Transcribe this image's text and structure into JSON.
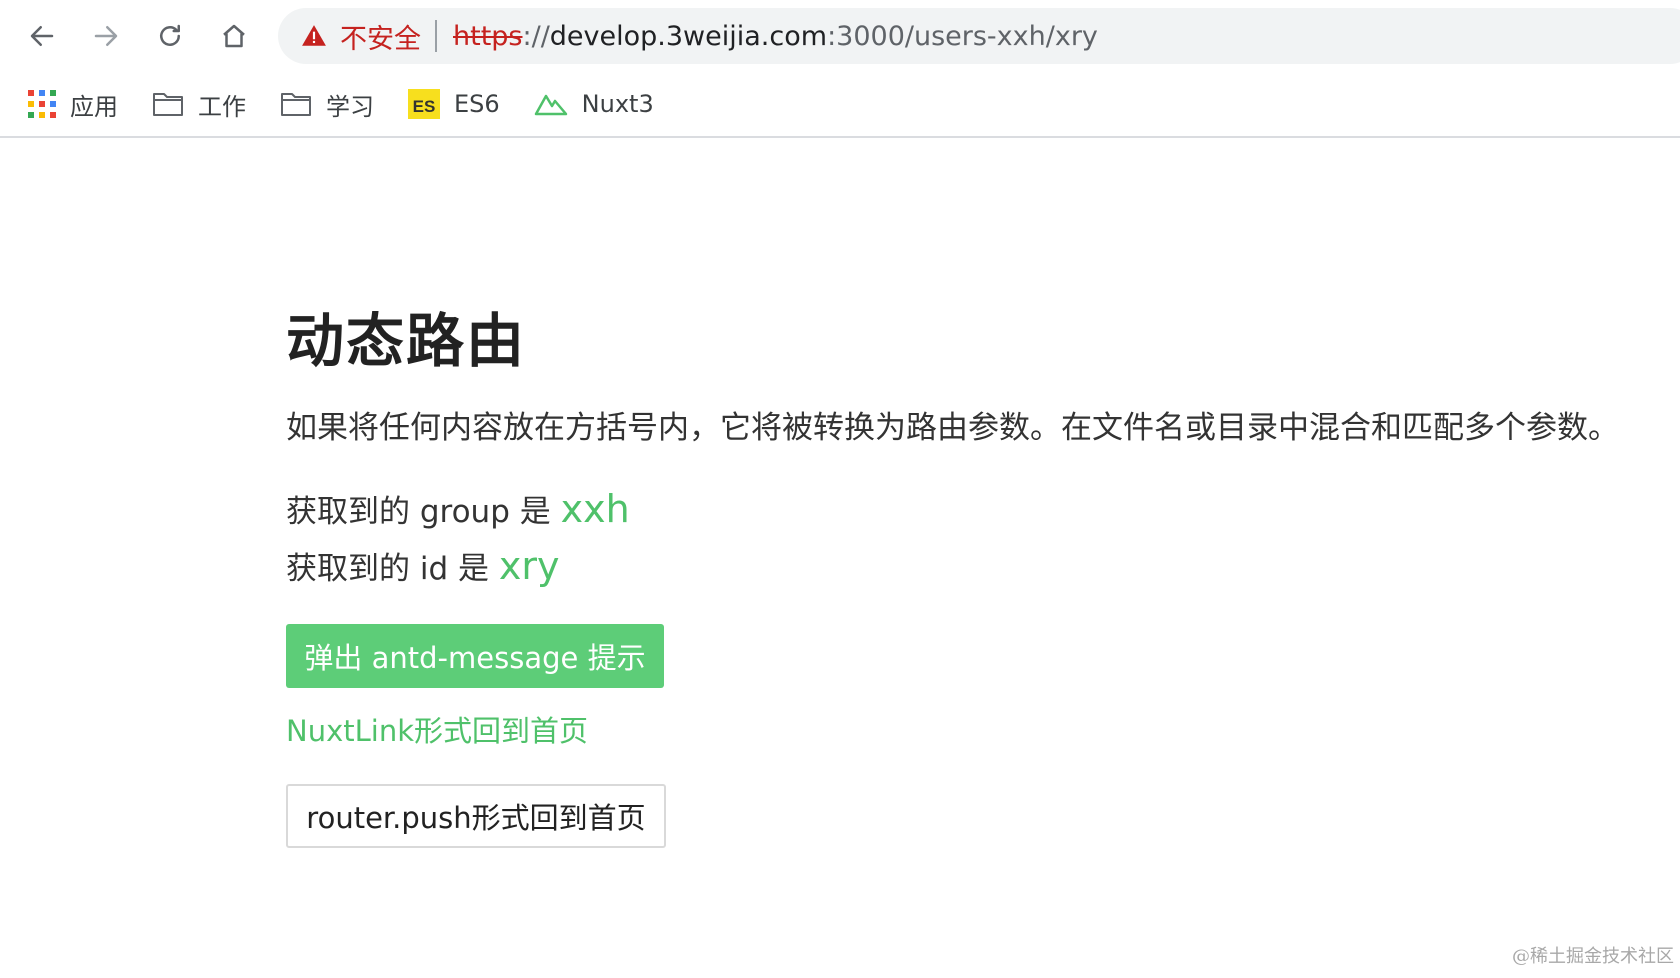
{
  "browser": {
    "security_text": "不安全",
    "url": {
      "scheme": "https",
      "separator": "://",
      "host": "develop.3weijia.com",
      "path": ":3000/users-xxh/xry"
    },
    "icons": {
      "back": "arrow-left-icon",
      "forward": "arrow-right-icon",
      "reload": "reload-icon",
      "home": "home-icon",
      "security": "warning-triangle-icon"
    }
  },
  "bookmarks": [
    {
      "label": "应用",
      "icon": "apps-grid-icon"
    },
    {
      "label": "工作",
      "icon": "folder-icon"
    },
    {
      "label": "学习",
      "icon": "folder-icon"
    },
    {
      "label": "ES6",
      "icon": "es-badge-icon",
      "badge": "ES"
    },
    {
      "label": "Nuxt3",
      "icon": "nuxt-logo-icon"
    }
  ],
  "page": {
    "title": "动态路由",
    "description": "如果将任何内容放在方括号内，它将被转换为路由参数。在文件名或目录中混合和匹配多个参数。",
    "group_line": {
      "prefix": "获取到的 group 是 ",
      "value": "xxh"
    },
    "id_line": {
      "prefix": "获取到的 id 是 ",
      "value": "xry"
    },
    "message_button": "弹出 antd-message 提示",
    "nuxt_link": "NuxtLink形式回到首页",
    "router_button": "router.push形式回到首页"
  },
  "watermark": "@稀土掘金技术社区",
  "colors": {
    "accent_green": "#5dcd78",
    "link_green": "#4fc16a",
    "warning_red": "#c5221f"
  }
}
